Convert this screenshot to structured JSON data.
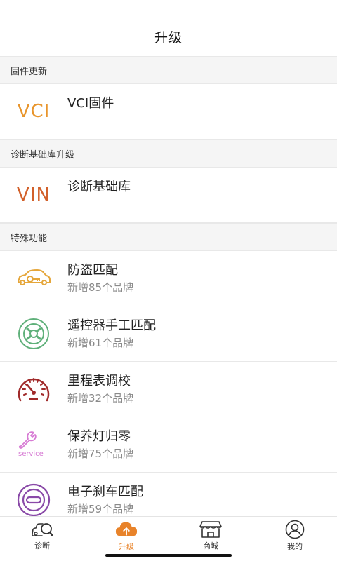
{
  "header": {
    "title": "升级"
  },
  "sections": {
    "firmware": {
      "title": "固件更新",
      "items": [
        {
          "icon_text": "VCI",
          "icon_color": "#e8952c",
          "name": "VCI固件"
        }
      ]
    },
    "database": {
      "title": "诊断基础库升级",
      "items": [
        {
          "icon_text": "VIN",
          "icon_color": "#d2602a",
          "name": "诊断基础库"
        }
      ]
    },
    "special": {
      "title": "特殊功能",
      "items": [
        {
          "icon": "car-key-icon",
          "name": "防盗匹配",
          "sub": "新增85个品牌"
        },
        {
          "icon": "remote-control-icon",
          "name": "遥控器手工匹配",
          "sub": "新增61个品牌"
        },
        {
          "icon": "speedometer-icon",
          "name": "里程表调校",
          "sub": "新增32个品牌"
        },
        {
          "icon": "wrench-service-icon",
          "icon_text": "service",
          "name": "保养灯归零",
          "sub": "新增75个品牌"
        },
        {
          "icon": "brake-icon",
          "name": "电子刹车匹配",
          "sub": "新增59个品牌"
        }
      ]
    }
  },
  "tabbar": {
    "tabs": [
      {
        "label": "诊断",
        "icon": "car-search-icon"
      },
      {
        "label": "升级",
        "icon": "cloud-upload-icon",
        "active": true
      },
      {
        "label": "商城",
        "icon": "shop-icon"
      },
      {
        "label": "我的",
        "icon": "user-icon"
      }
    ]
  },
  "colors": {
    "accent": "#e8832a",
    "section_bg": "#f5f5f5",
    "divider": "#e8e8e8"
  }
}
